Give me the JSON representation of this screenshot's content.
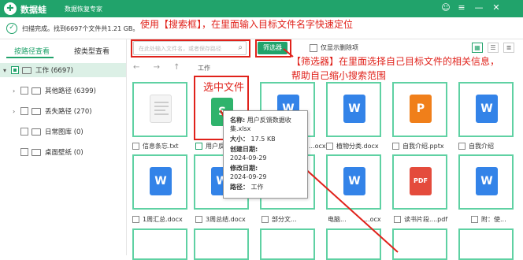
{
  "titlebar": {
    "app": "数据蛙",
    "subtitle": "数据恢复专家"
  },
  "scan": {
    "text": "扫描完成。找到6697个文件共1.21 GB。"
  },
  "annotations": {
    "search": "使用【搜索框】，在里面输入目标文件名字快速定位",
    "filter1": "【筛选器】在里面选择自己目标文件的相关信息，",
    "filter2": "帮助自己缩小搜索范围",
    "select": "选中文件"
  },
  "tabs": {
    "by_path": "按路径查看",
    "by_type": "按类型查看"
  },
  "tree": {
    "work": "工作 (6697)",
    "other": "其他路径 (6399)",
    "lost": "丢失路径 (270)",
    "gallery": "日常图库 (0)",
    "wallpaper": "桌面壁纸 (0)"
  },
  "toolbar": {
    "search_placeholder": "在此处输入文件名，或者保存路径",
    "filter_label": "筛选器",
    "show_deleted": "仅显示删除项"
  },
  "nav": {
    "back": "←",
    "forward": "→",
    "up": "↑",
    "crumb": "工作"
  },
  "files": {
    "f1": "信息条忘.txt",
    "f2": "用户反馈",
    "f3": "...ocx",
    "f4": "植物分类.docx",
    "f5": "自我介绍.pptx",
    "f6": "自我介绍",
    "f7": "1周汇总.docx",
    "f8": "3周总结.docx",
    "f9": "部分文...",
    "f10": "电脑...",
    "f11": "...ocx",
    "f12": "读书片段....pdf",
    "f13": "附：使..."
  },
  "popup": {
    "name_label": "名称:",
    "name": "用户反馈数据收集.xlsx",
    "size_label": "大小：",
    "size": "17.5 KB",
    "created_label": "创建日期:",
    "created": "2024-09-29",
    "modified_label": "修改日期:",
    "modified": "2024-09-29",
    "path_label": "路径：",
    "path": "工作"
  },
  "colors": {
    "brand": "#21a36b",
    "annotation": "#e0221b",
    "tile_border": "#5fd1a3"
  }
}
